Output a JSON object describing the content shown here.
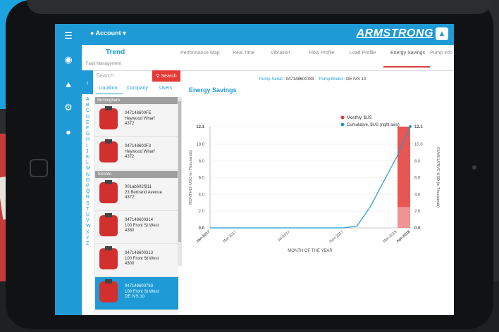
{
  "header": {
    "account_label": "Account",
    "logo_text": "ARMSTRONG"
  },
  "tabs": [
    {
      "label": "Trend"
    },
    {
      "label": "Performance Map"
    },
    {
      "label": "Real Time"
    },
    {
      "label": "Vibration"
    },
    {
      "label": "Flow Profile"
    },
    {
      "label": "Load Profile"
    },
    {
      "label": "Energy Savings"
    },
    {
      "label": "Pump Info"
    }
  ],
  "subtab": "Fault Management",
  "search": {
    "placeholder": "Search",
    "button": "Search"
  },
  "filters": [
    "Location",
    "Company",
    "Users"
  ],
  "alphabet": [
    "A",
    "B",
    "C",
    "D",
    "E",
    "F",
    "G",
    "H",
    "I",
    "J",
    "K",
    "L",
    "M",
    "N",
    "O",
    "P",
    "Q",
    "R",
    "S",
    "T",
    "U",
    "V",
    "W",
    "X",
    "Y",
    "Z"
  ],
  "groups": [
    {
      "name": "Birmingham"
    },
    {
      "name": "Toronto"
    }
  ],
  "pumps": [
    {
      "serial": "047148600FE",
      "address": "Heywood Wharf",
      "number": "4372"
    },
    {
      "serial": "047148600F3",
      "address": "Heywood Wharf",
      "number": "4372"
    },
    {
      "serial": "001ab602f911",
      "address": "23 Bertrand Avenue",
      "number": "4372"
    },
    {
      "serial": "047148600314",
      "address": "100 Front St West",
      "number": "4380"
    },
    {
      "serial": "047148600313",
      "address": "100 Front St West",
      "number": "4300"
    },
    {
      "serial": "047148600783",
      "address": "100 Front St West",
      "number": "DE IVS 10"
    }
  ],
  "pump_info": {
    "serial_label": "Pump Serial :",
    "serial": "047148600783",
    "model_label": "Pump Model :",
    "model": "DE IVS 10"
  },
  "chart_data": {
    "type": "line",
    "title": "Energy Savings",
    "xlabel": "MONTH OF THE YEAR",
    "ylabel": "MONTHLY USD (in Thousands)",
    "y2label": "CUMULATIVE USD (in Thousands)",
    "x_ticks": [
      "Jan-2017",
      "Mar-2017",
      "Jul-2017",
      "Nov-2017",
      "Mar-2018",
      "Apr-2018"
    ],
    "y_ticks": [
      "0.0",
      "2.0",
      "4.0",
      "6.0",
      "8.0",
      "10.0",
      "12.1"
    ],
    "ylim": [
      0,
      12.1
    ],
    "legend": [
      "Monthly, $US",
      "Cumulative, $US (right axis)"
    ],
    "legend_position": "top-right",
    "colors": {
      "monthly": "#e53935",
      "cumulative": "#1e9ad6"
    },
    "series": [
      {
        "name": "Monthly, $US",
        "type": "bar",
        "x": [
          "Apr-2018"
        ],
        "values": [
          12.1
        ]
      },
      {
        "name": "Cumulative, $US (right axis)",
        "type": "line",
        "x": [
          "Jan-2017",
          "Mar-2017",
          "Jul-2017",
          "Nov-2017",
          "Dec-2017",
          "Jan-2018",
          "Feb-2018",
          "Mar-2018",
          "Apr-2018"
        ],
        "values": [
          0,
          0,
          0,
          0,
          0.2,
          2.5,
          5.5,
          8.5,
          12.1
        ]
      }
    ]
  }
}
